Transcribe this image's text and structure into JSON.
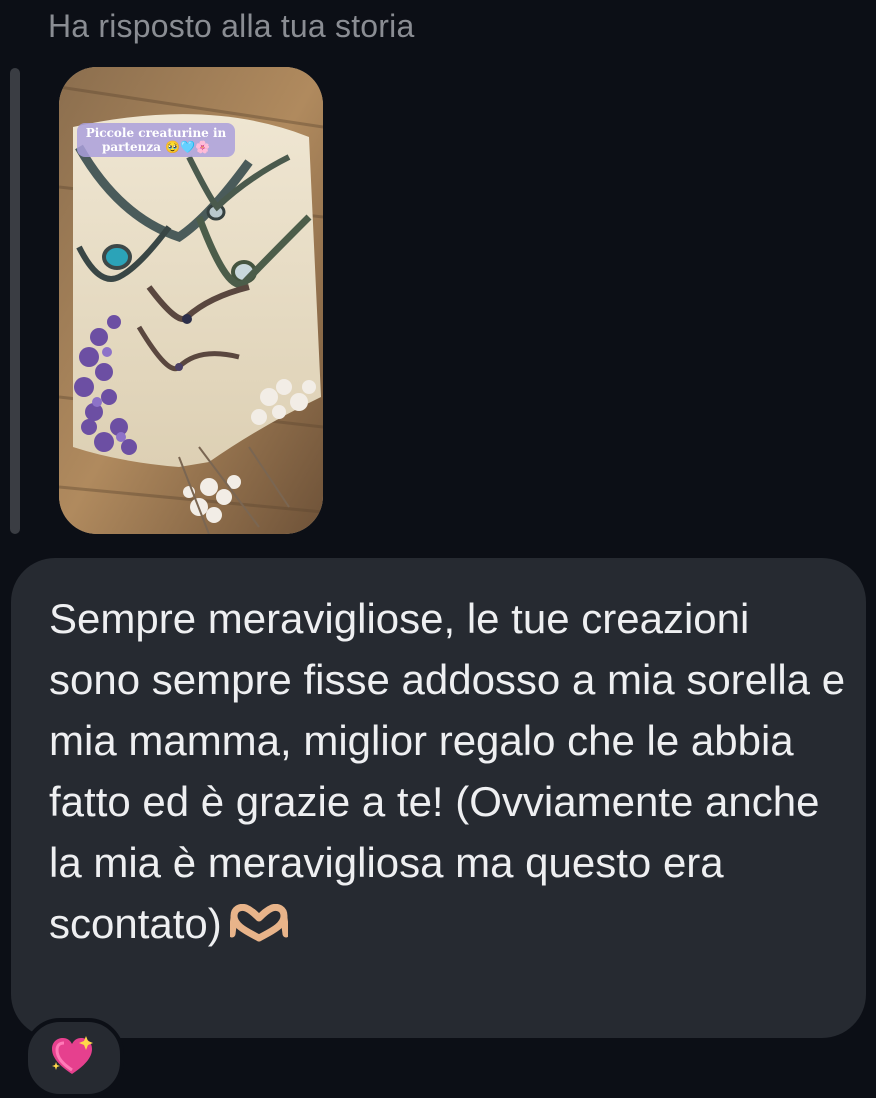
{
  "reply": {
    "header": "Ha risposto alla tua storia",
    "story": {
      "caption": "Piccole creaturine in partenza 🥹🩵🌸"
    }
  },
  "message": {
    "text": "Sempre meravigliose, le tue creazioni sono sempre fisse addosso a mia sorella e mia mamma, miglior regalo che le abbia fatto ed è grazie a te! (Ovviamente anche la mia è meravigliosa ma questo era scontato)",
    "emoji_icon": "heart-hands-icon"
  },
  "reaction": {
    "icon": "sparkling-heart-icon"
  },
  "colors": {
    "background": "#0c0f16",
    "bubble": "#262a31",
    "text": "#eeeff1",
    "header_text": "#8a8d93"
  }
}
